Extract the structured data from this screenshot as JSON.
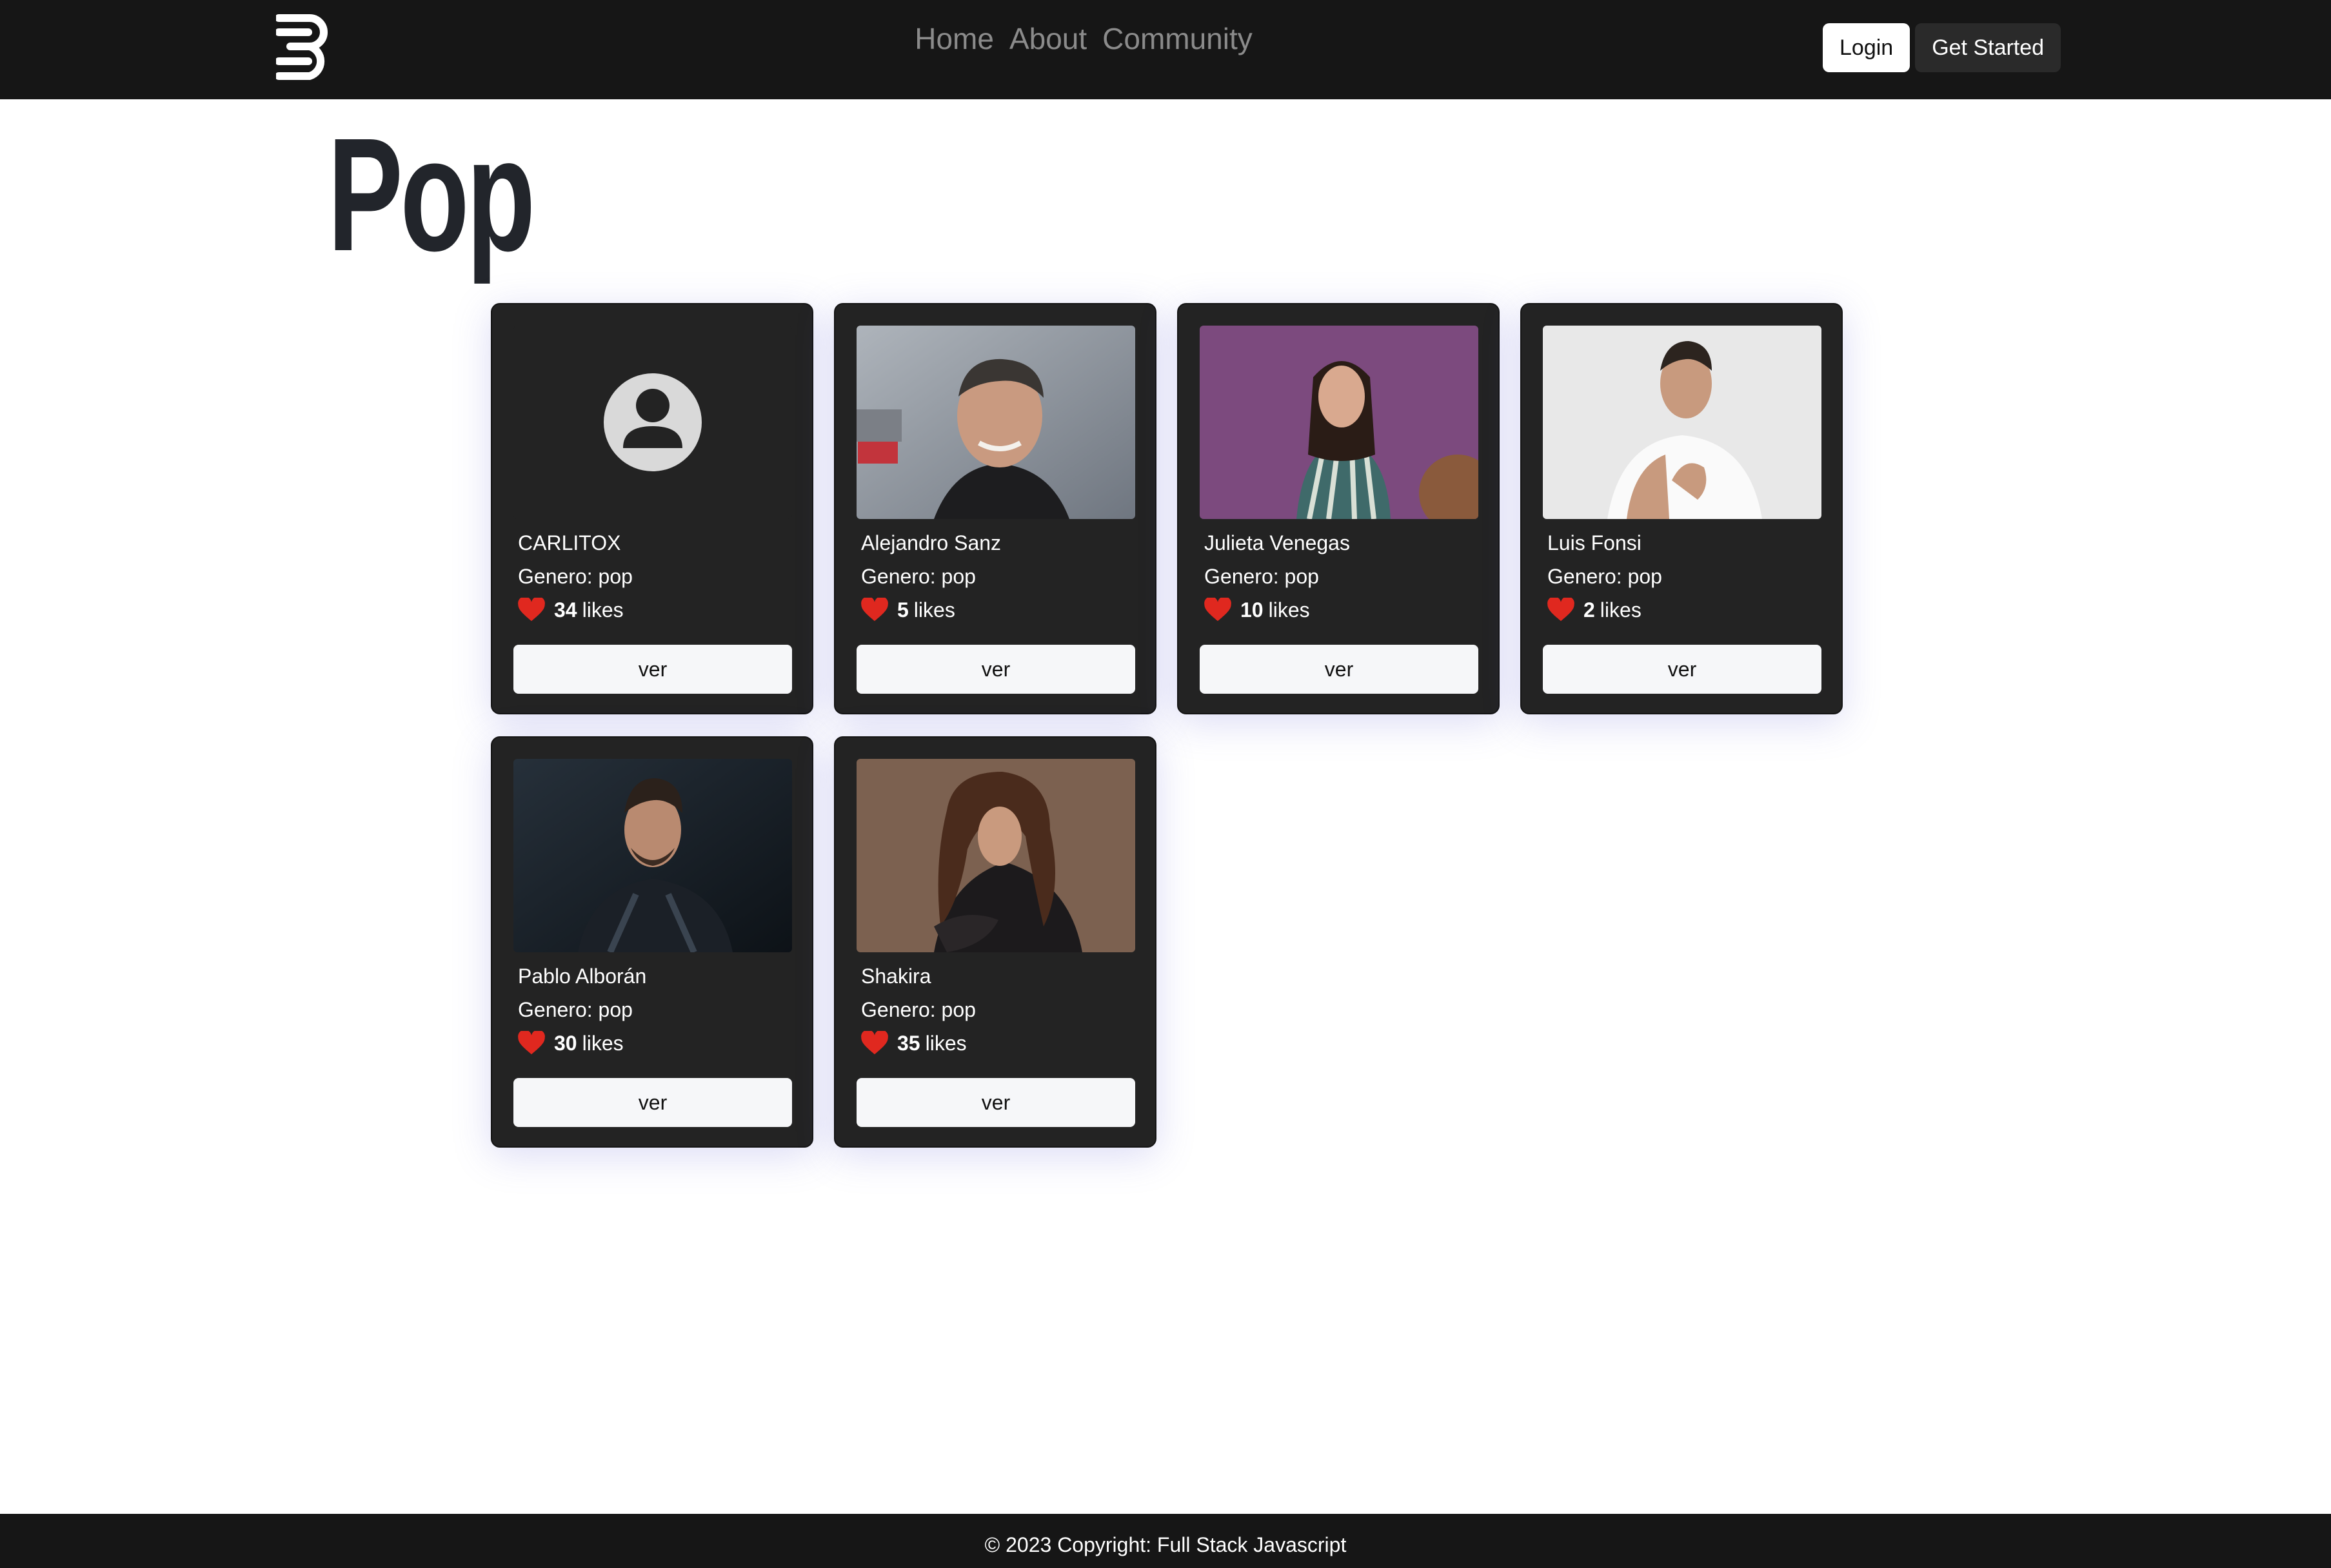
{
  "nav": {
    "links": [
      {
        "label": "Home"
      },
      {
        "label": "About"
      },
      {
        "label": "Community"
      }
    ],
    "login_label": "Login",
    "get_started_label": "Get Started"
  },
  "page": {
    "title": "Pop"
  },
  "cards": [
    {
      "name": "CARLITOX",
      "genre": "Genero: pop",
      "likes": "34",
      "likes_label": "likes",
      "button_label": "ver",
      "image": "user-placeholder-icon"
    },
    {
      "name": "Alejandro Sanz",
      "genre": "Genero: pop",
      "likes": "5",
      "likes_label": "likes",
      "button_label": "ver",
      "image": "artist-photo"
    },
    {
      "name": "Julieta Venegas",
      "genre": "Genero: pop",
      "likes": "10",
      "likes_label": "likes",
      "button_label": "ver",
      "image": "artist-photo"
    },
    {
      "name": "Luis Fonsi",
      "genre": "Genero: pop",
      "likes": "2",
      "likes_label": "likes",
      "button_label": "ver",
      "image": "artist-photo"
    },
    {
      "name": "Pablo Alborán",
      "genre": "Genero: pop",
      "likes": "30",
      "likes_label": "likes",
      "button_label": "ver",
      "image": "artist-photo"
    },
    {
      "name": "Shakira",
      "genre": "Genero: pop",
      "likes": "35",
      "likes_label": "likes",
      "button_label": "ver",
      "image": "artist-photo"
    }
  ],
  "footer": {
    "text": "© 2023 Copyright: Full Stack Javascript"
  },
  "colors": {
    "navbar": "#161616",
    "card_bg": "#232323",
    "heart": "#e0281f",
    "title": "#22252b"
  }
}
